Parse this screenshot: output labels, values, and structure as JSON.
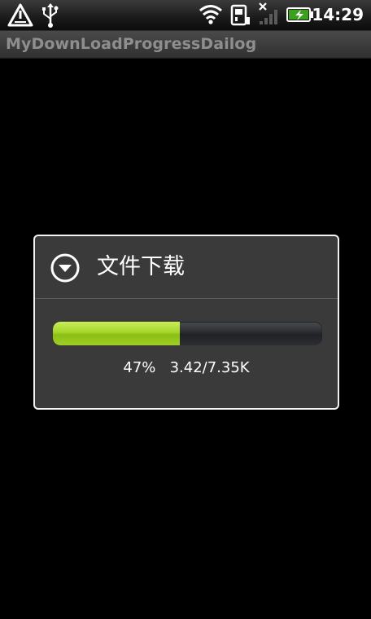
{
  "status_bar": {
    "time": "14:29",
    "icons": [
      "warning-icon",
      "usb-icon",
      "wifi-icon",
      "sim-icon",
      "no-signal-icon",
      "battery-charging-icon"
    ]
  },
  "app": {
    "title": "MyDownLoadProgressDailog"
  },
  "dialog": {
    "title": "文件下载",
    "icon": "chevron-down-circle-icon",
    "progress": {
      "percent": 47,
      "percent_text": "47%",
      "size_text": "3.42/7.35K"
    }
  },
  "colors": {
    "progress_fill": "#a5d528",
    "progress_track": "#2a2c30",
    "dialog_bg": "#3a3a3a",
    "dialog_border": "#f2f2f2",
    "title_text": "#8e8e8e"
  }
}
